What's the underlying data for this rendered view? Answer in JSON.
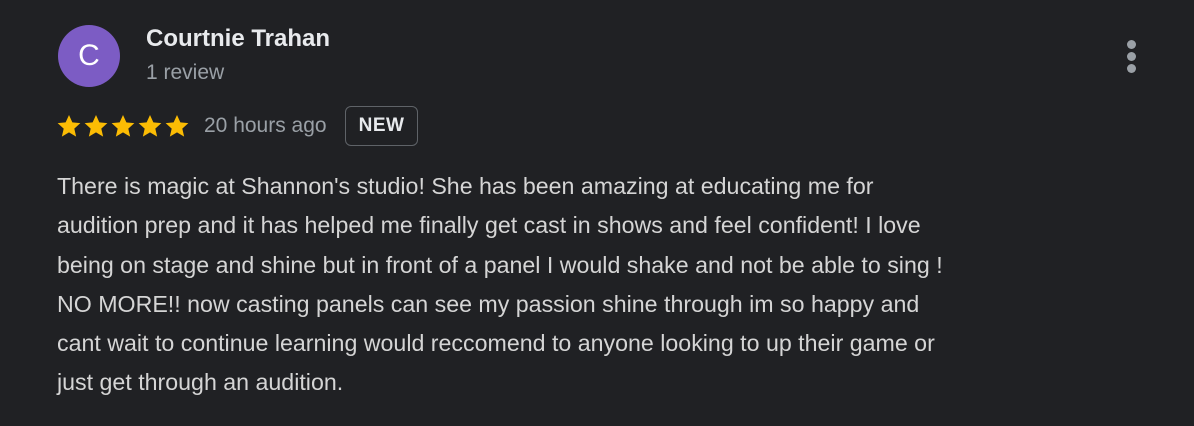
{
  "review": {
    "avatar_letter": "C",
    "avatar_color": "#7c5cc4",
    "author_name": "Courtnie Trahan",
    "review_count": "1 review",
    "rating": 5,
    "max_rating": 5,
    "star_color": "#fbbc04",
    "time_ago": "20 hours ago",
    "badge": "NEW",
    "more_menu_icon": "more-vert-icon",
    "text_lines": [
      "There is magic at Shannon's studio! She has been amazing at educating me for",
      "audition prep and it has helped me finally get cast in shows and feel confident! I love",
      "being on stage and shine but in front of a panel I would shake and not be able to sing !",
      "NO MORE!! now casting panels can see my passion shine through im so happy and",
      "cant wait to continue learning would reccomend to anyone looking to up their game or",
      "just get through an audition."
    ]
  }
}
